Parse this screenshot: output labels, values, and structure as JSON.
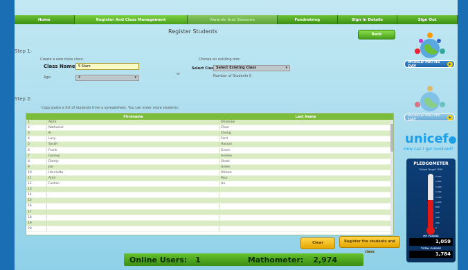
{
  "nav": {
    "tabs": [
      {
        "label": "Home",
        "state": "normal"
      },
      {
        "label": "Register And Class Management",
        "state": "active"
      },
      {
        "label": "Awards And Seasons",
        "state": "dim"
      },
      {
        "label": "Fundraising",
        "state": "normal"
      },
      {
        "label": "Sign In Details",
        "state": "normal"
      },
      {
        "label": "Sign Out",
        "state": "normal"
      }
    ]
  },
  "page": {
    "title": "Register Students",
    "back_label": "Back"
  },
  "step1": {
    "heading": "Step 1:",
    "create_hint": "Create a new class class:",
    "class_name_label": "Class Name",
    "class_name_value": "5 Stars",
    "age_label": "Age:",
    "age_value": "4",
    "or_text": "or",
    "choose_hint": "Choose an existing one:",
    "select_class_label": "Select Class",
    "select_class_value": "Select Existing Class",
    "students_count_text": "Number of Students 0"
  },
  "step2": {
    "heading": "Step 2:",
    "hint": "Copy paste a list of students from a spreadsheet. You can enter more students:"
  },
  "grid": {
    "headers": [
      "",
      "Firstname",
      "Last Name"
    ],
    "rows": [
      {
        "num": "1",
        "first": "Akhil",
        "last": "Dharluka"
      },
      {
        "num": "2",
        "first": "Nathaniel",
        "last": "Chan"
      },
      {
        "num": "3",
        "first": "Ki",
        "last": "Cheng"
      },
      {
        "num": "4",
        "first": "Lucy",
        "last": "Ford"
      },
      {
        "num": "5",
        "first": "Sarah",
        "last": "Hassan"
      },
      {
        "num": "6",
        "first": "Frank",
        "last": "Green"
      },
      {
        "num": "7",
        "first": "Gurney",
        "last": "Andrea"
      },
      {
        "num": "8",
        "first": "Dimity",
        "last": "Shrek"
      },
      {
        "num": "9",
        "first": "Joe",
        "last": "Green"
      },
      {
        "num": "10",
        "first": "Henrietta",
        "last": "Ohlsen"
      },
      {
        "num": "11",
        "first": "Amir",
        "last": "Pour"
      },
      {
        "num": "12",
        "first": "Fuzhan",
        "last": "Hu"
      },
      {
        "num": "13",
        "first": "",
        "last": ""
      },
      {
        "num": "14",
        "first": "",
        "last": ""
      },
      {
        "num": "15",
        "first": "",
        "last": ""
      },
      {
        "num": "16",
        "first": "",
        "last": ""
      },
      {
        "num": "17",
        "first": "",
        "last": ""
      },
      {
        "num": "18",
        "first": "",
        "last": ""
      },
      {
        "num": "19",
        "first": "",
        "last": ""
      },
      {
        "num": "20",
        "first": "",
        "last": ""
      }
    ]
  },
  "actions": {
    "clear_label": "Clear",
    "register_label": "Register the students and class"
  },
  "footer": {
    "online_label": "Online Users:",
    "online_value": "1",
    "mathometer_label": "Mathometer:",
    "mathometer_value": "2,974"
  },
  "sidebar": {
    "wmd_label": "WORLD MATHS DAY",
    "unicef_text": "unicef",
    "unicef_sub": "How can I get involved?",
    "pledgometer_title": "PLEDGOMETER",
    "pledgometer_sub": "School Target 1500",
    "ticks": [
      "2,000",
      "1,800",
      "1,600",
      "1,400",
      "1,200",
      "1,000",
      "800",
      "600",
      "400",
      "200",
      "0"
    ],
    "fill_fraction": 0.53,
    "my_pledge_label": "MY PLEDGE",
    "my_pledge_value": "1,059",
    "total_label": "TOTAL PLEDGE",
    "total_value": "1,784"
  },
  "colors": {
    "accent_green": "#4aa01b",
    "background": "#a6dbed",
    "frame": "#1a6fb4",
    "button_yellow": "#e5a600"
  }
}
